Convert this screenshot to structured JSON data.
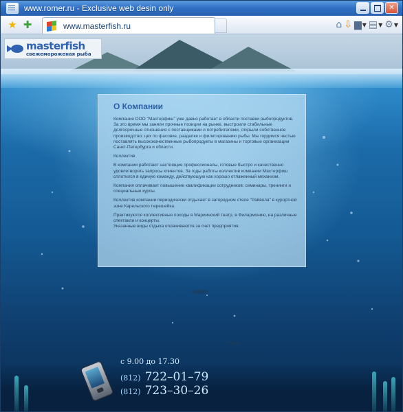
{
  "window": {
    "title": "www.romer.ru - Exclusive web desin only"
  },
  "browser": {
    "tab_title": "www.masterfish.ru",
    "icons": [
      "favorites-star-icon",
      "add-favorites-icon",
      "home-icon",
      "feed-icon",
      "print-icon",
      "page-menu-icon",
      "tools-gear-icon"
    ]
  },
  "site": {
    "logo_name": "masterfish",
    "logo_tagline": "свежемороженая рыба"
  },
  "content": {
    "title": "О Компании",
    "paragraphs": [
      "Компания ООО \"Мастерфиш\" уже давно работает в области поставки рыбопродуктов. За это время мы заняли прочные позиции на рынке, выстроили стабильные долгосрочные отношения с поставщиками и потребителями, открыли собственное производство: цех по фасовке, разделке и филетированию рыбы. Мы гордимся честью поставлять высококачественные рыбопродукты в магазины и торговые организации Санкт-Петербурга и области.",
      "Коллектив",
      "В компании работают настоящие профессионалы, готовые быстро и качественно удовлетворять запросы клиентов. За годы работы коллектив компании Мастерфиш сплотился в единую команду, действующую как хорошо отлаженный механизм.",
      "Компания оплачивает повышение квалификации сотрудников: семинары, тренинги и специальные курсы.",
      "Коллектив компании периодически отдыхает в загородном отеле \"Райвола\" в курортной зоне Карельского перешейка.",
      "Практикуются коллективные походы в Мариинский театр, в Филармонию, на различные спектакли и концерты.\nУказанные виды отдыха оплачиваются за счет предприятия."
    ]
  },
  "contact": {
    "hours": "с 9.00 до 17.30",
    "phone1_code": "(812)",
    "phone1_number": "722–01–79",
    "phone2_code": "(812)",
    "phone2_number": "723–30–26"
  },
  "colors": {
    "titlebar": "#2f6fc4",
    "water_top": "#5fb7e8",
    "water_deep": "#0a2c52",
    "panel_title": "#2c5fa5",
    "contact_text": "#cde9ff"
  }
}
